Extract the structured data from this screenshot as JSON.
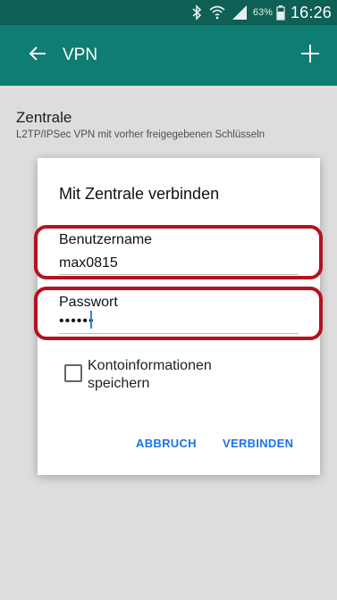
{
  "status_bar": {
    "icons": [
      "bluetooth-icon",
      "wifi-icon",
      "signal-icon",
      "battery-icon"
    ],
    "battery_percent": "63%",
    "time": "16:26"
  },
  "app_bar": {
    "title": "VPN",
    "back_icon": "arrow-left-icon",
    "add_icon": "plus-icon"
  },
  "vpn_list": [
    {
      "name": "Zentrale",
      "type": "L2TP/IPSec VPN mit vorher freigegebenen Schlüsseln"
    }
  ],
  "dialog": {
    "title": "Mit Zentrale verbinden",
    "username_label": "Benutzername",
    "username_value": "max0815",
    "password_label": "Passwort",
    "password_value": "••••••",
    "save_account_label": "Kontoinformationen speichern",
    "save_account_checked": false,
    "cancel_label": "ABBRUCH",
    "connect_label": "VERBINDEN"
  },
  "colors": {
    "status_bar": "#0e5f55",
    "app_bar": "#0f7d71",
    "accent": "#1a73e8",
    "highlight": "#b3121f"
  }
}
